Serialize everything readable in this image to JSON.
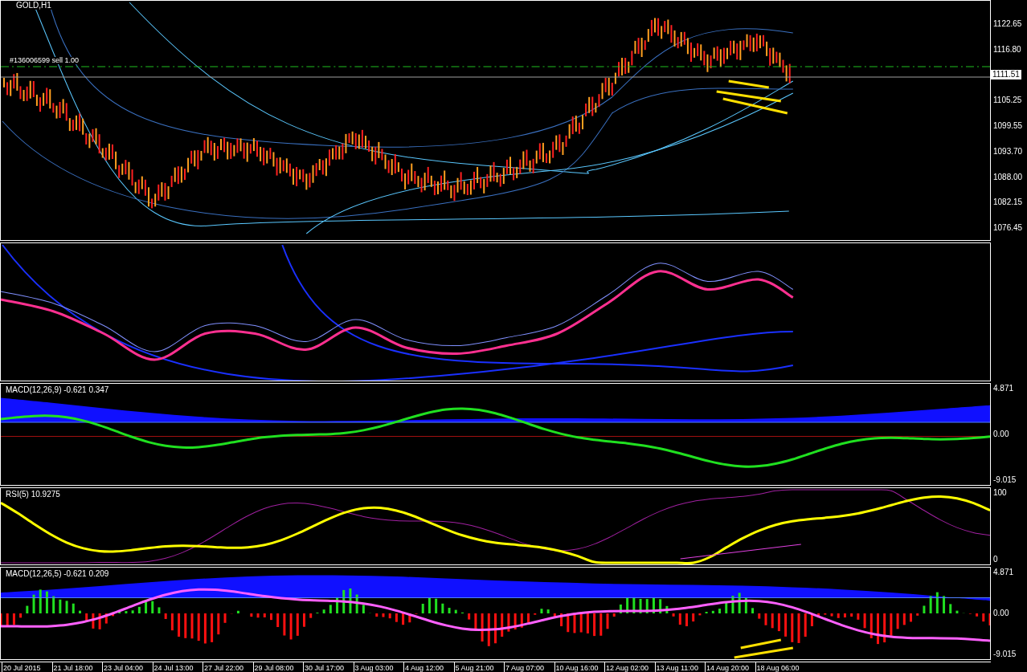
{
  "chart": {
    "title": "GOLD,H1",
    "order_label": "#136006599 sell 1.00",
    "price_label": "1111.51"
  },
  "panels": [
    {
      "kind": "price",
      "axis": [
        "1122.65",
        "1116.80",
        "1105.25",
        "1099.55",
        "1093.70",
        "1088.00",
        "1082.15",
        "1076.45"
      ]
    },
    {
      "kind": "bands"
    },
    {
      "kind": "macd",
      "label": "MACD(12,26,9) -0.621 0.347",
      "axis": [
        "4.871",
        "0.00",
        "-9.015"
      ]
    },
    {
      "kind": "rsi",
      "label": "RSI(5) 10.9275",
      "axis": [
        "100",
        "0"
      ]
    },
    {
      "kind": "macd2",
      "label": "MACD(12,26,5) -0.621 0.209",
      "axis": [
        "4.871",
        "0.00",
        "-9.015"
      ]
    }
  ],
  "time_axis": [
    "20 Jul 2015",
    "21 Jul 18:00",
    "23 Jul 04:00",
    "24 Jul 13:00",
    "27 Jul 22:00",
    "29 Jul 08:00",
    "30 Jul 17:00",
    "3 Aug 03:00",
    "4 Aug 12:00",
    "5 Aug 21:00",
    "7 Aug 07:00",
    "10 Aug 16:00",
    "12 Aug 02:00",
    "13 Aug 11:00",
    "14 Aug 20:00",
    "18 Aug 06:00"
  ]
}
